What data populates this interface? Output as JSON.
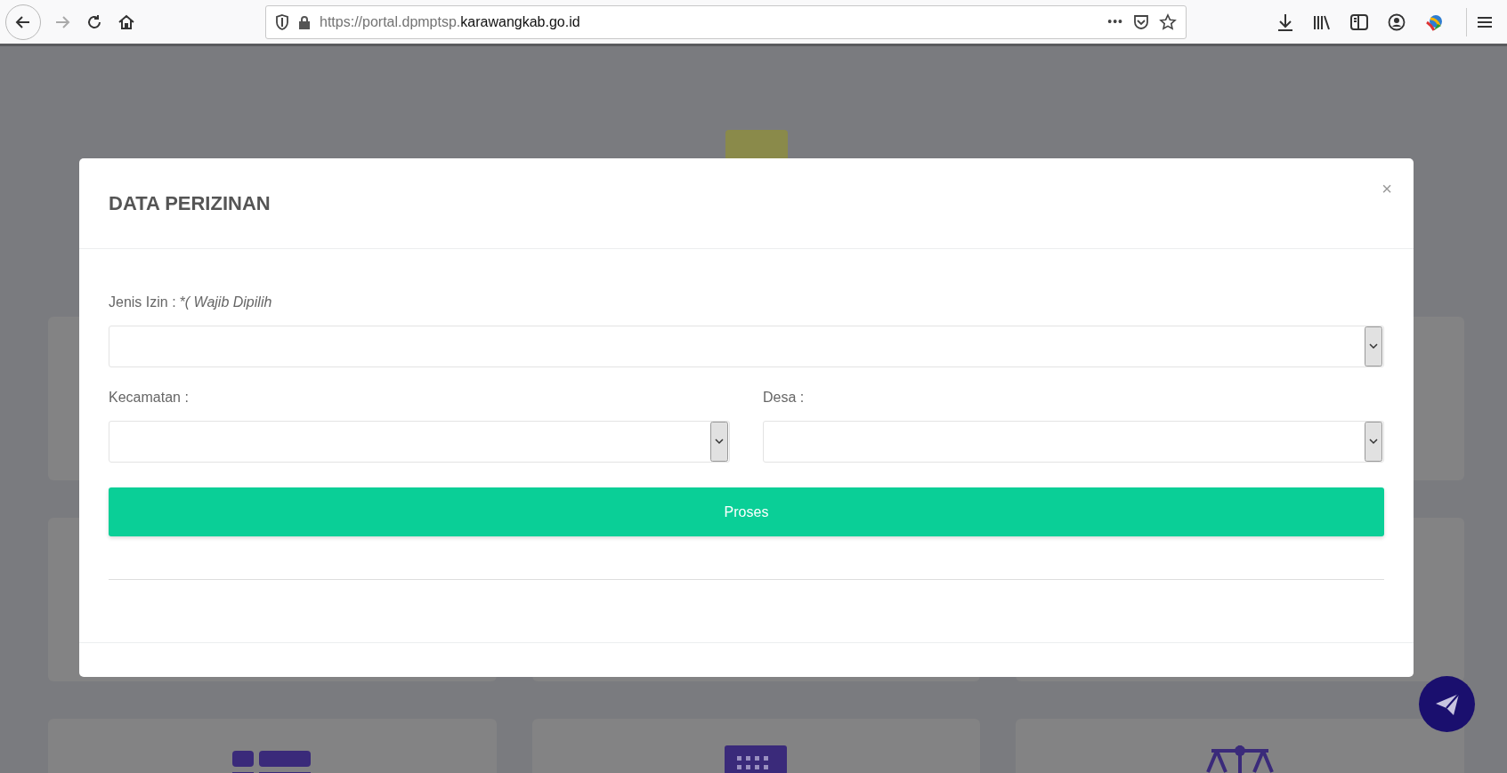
{
  "browser": {
    "url_prefix": "https://portal.dpmptsp.",
    "url_domain": "karawangkab.go.id",
    "menu_dots": "•••"
  },
  "modal": {
    "title": "DATA PERIZINAN",
    "close": "×",
    "rows": [
      [
        {
          "label": "Jenis Izin :",
          "note": "*( Wajib Dipilih"
        }
      ],
      [
        {
          "label": "Kecamatan :"
        },
        {
          "label": "Desa :"
        }
      ]
    ],
    "submit": "Proses"
  }
}
